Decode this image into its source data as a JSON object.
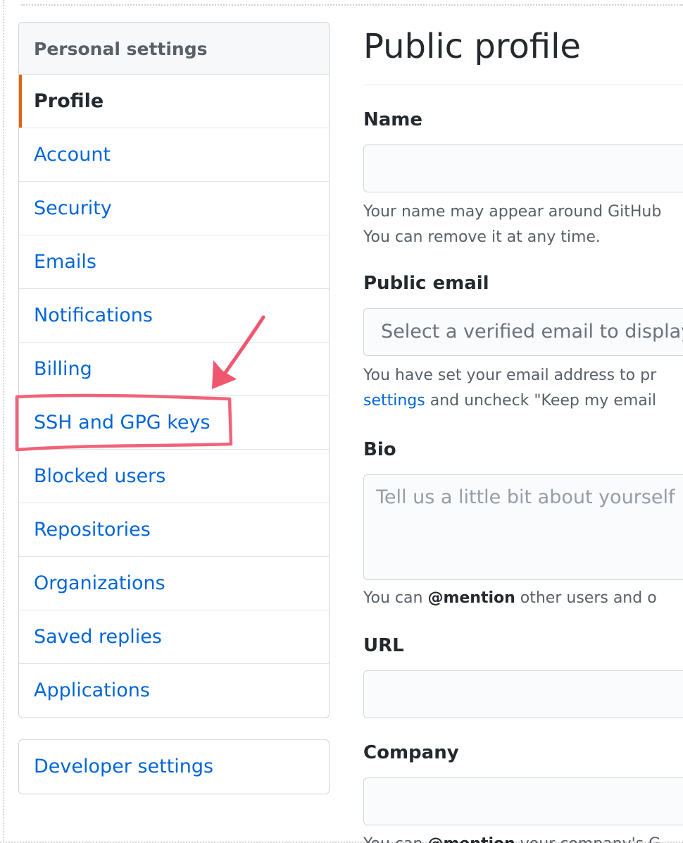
{
  "sidebar": {
    "heading": "Personal settings",
    "items": [
      {
        "label": "Profile"
      },
      {
        "label": "Account"
      },
      {
        "label": "Security"
      },
      {
        "label": "Emails"
      },
      {
        "label": "Notifications"
      },
      {
        "label": "Billing"
      },
      {
        "label": "SSH and GPG keys"
      },
      {
        "label": "Blocked users"
      },
      {
        "label": "Repositories"
      },
      {
        "label": "Organizations"
      },
      {
        "label": "Saved replies"
      },
      {
        "label": "Applications"
      }
    ],
    "selected": "Profile",
    "developer_settings": "Developer settings"
  },
  "main": {
    "title": "Public profile",
    "name": {
      "label": "Name",
      "value": "",
      "note_line1": "Your name may appear around GitHub",
      "note_line2": "You can remove it at any time."
    },
    "public_email": {
      "label": "Public email",
      "placeholder": "Select a verified email to display",
      "note_line1": "You have set your email address to pr",
      "note_link": "settings",
      "note_line2_rest": " and uncheck \"Keep my email"
    },
    "bio": {
      "label": "Bio",
      "placeholder": "Tell us a little bit about yourself",
      "note_prefix": "You can ",
      "note_mention": "@mention",
      "note_suffix": " other users and o"
    },
    "url": {
      "label": "URL",
      "value": ""
    },
    "company": {
      "label": "Company",
      "value": "",
      "note_prefix": "You can ",
      "note_mention": "@mention",
      "note_suffix": " your company's G"
    }
  },
  "colors": {
    "link": "#0366d6",
    "selected_accent": "#e36209",
    "annotation": "#f0566e"
  }
}
